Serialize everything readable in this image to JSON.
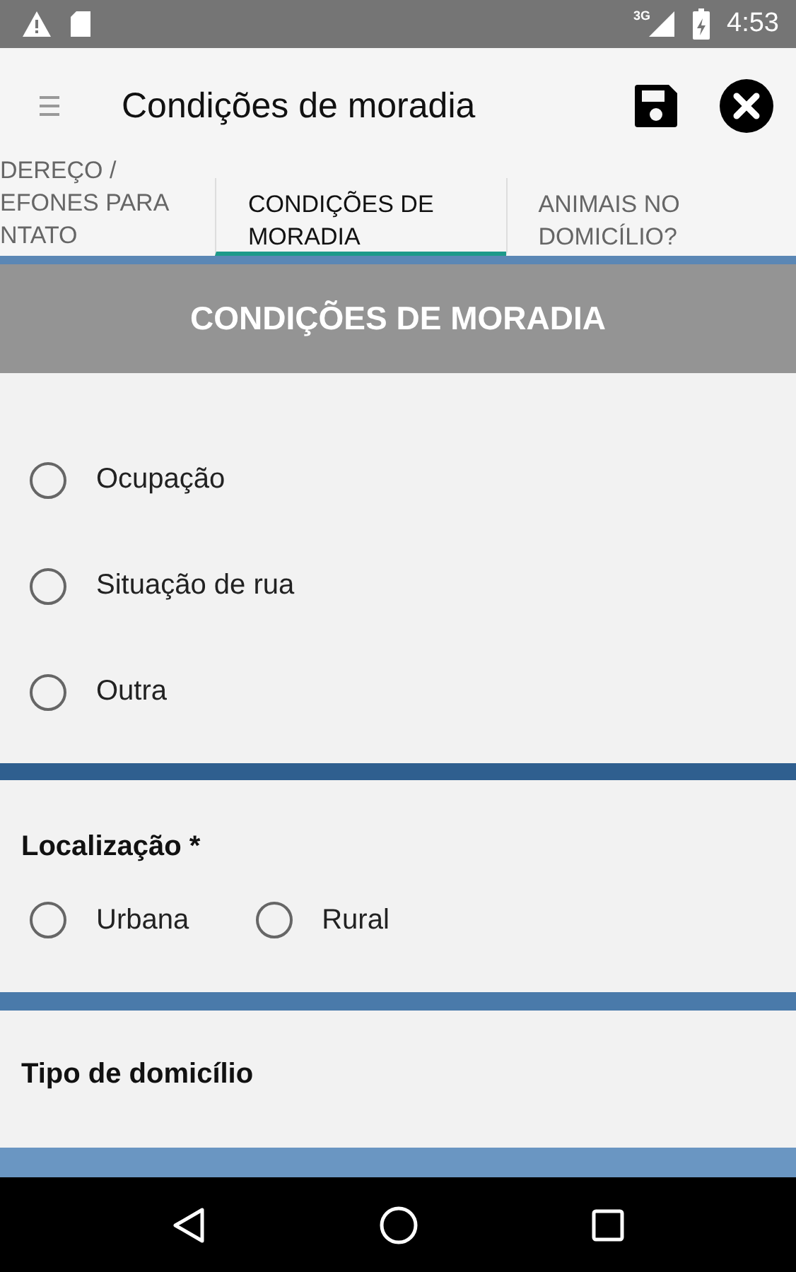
{
  "status_bar": {
    "network": "3G",
    "time": "4:53"
  },
  "app_bar": {
    "title": "Condições de moradia"
  },
  "tabs": [
    {
      "label": "DEREÇO / EFONES PARA NTATO",
      "selected": false
    },
    {
      "label": "CONDIÇÕES DE MORADIA",
      "selected": true
    },
    {
      "label": "ANIMAIS NO DOMICÍLIO?",
      "selected": false
    }
  ],
  "section_header": "CONDIÇÕES DE MORADIA",
  "sections": [
    {
      "options": [
        {
          "label": "Ocupação",
          "selected": false
        },
        {
          "label": "Situação de rua",
          "selected": false
        },
        {
          "label": "Outra",
          "selected": false
        }
      ]
    },
    {
      "label": "Localização *",
      "options": [
        {
          "label": "Urbana",
          "selected": false
        },
        {
          "label": "Rural",
          "selected": false
        }
      ]
    },
    {
      "label": "Tipo de domicílio"
    }
  ]
}
